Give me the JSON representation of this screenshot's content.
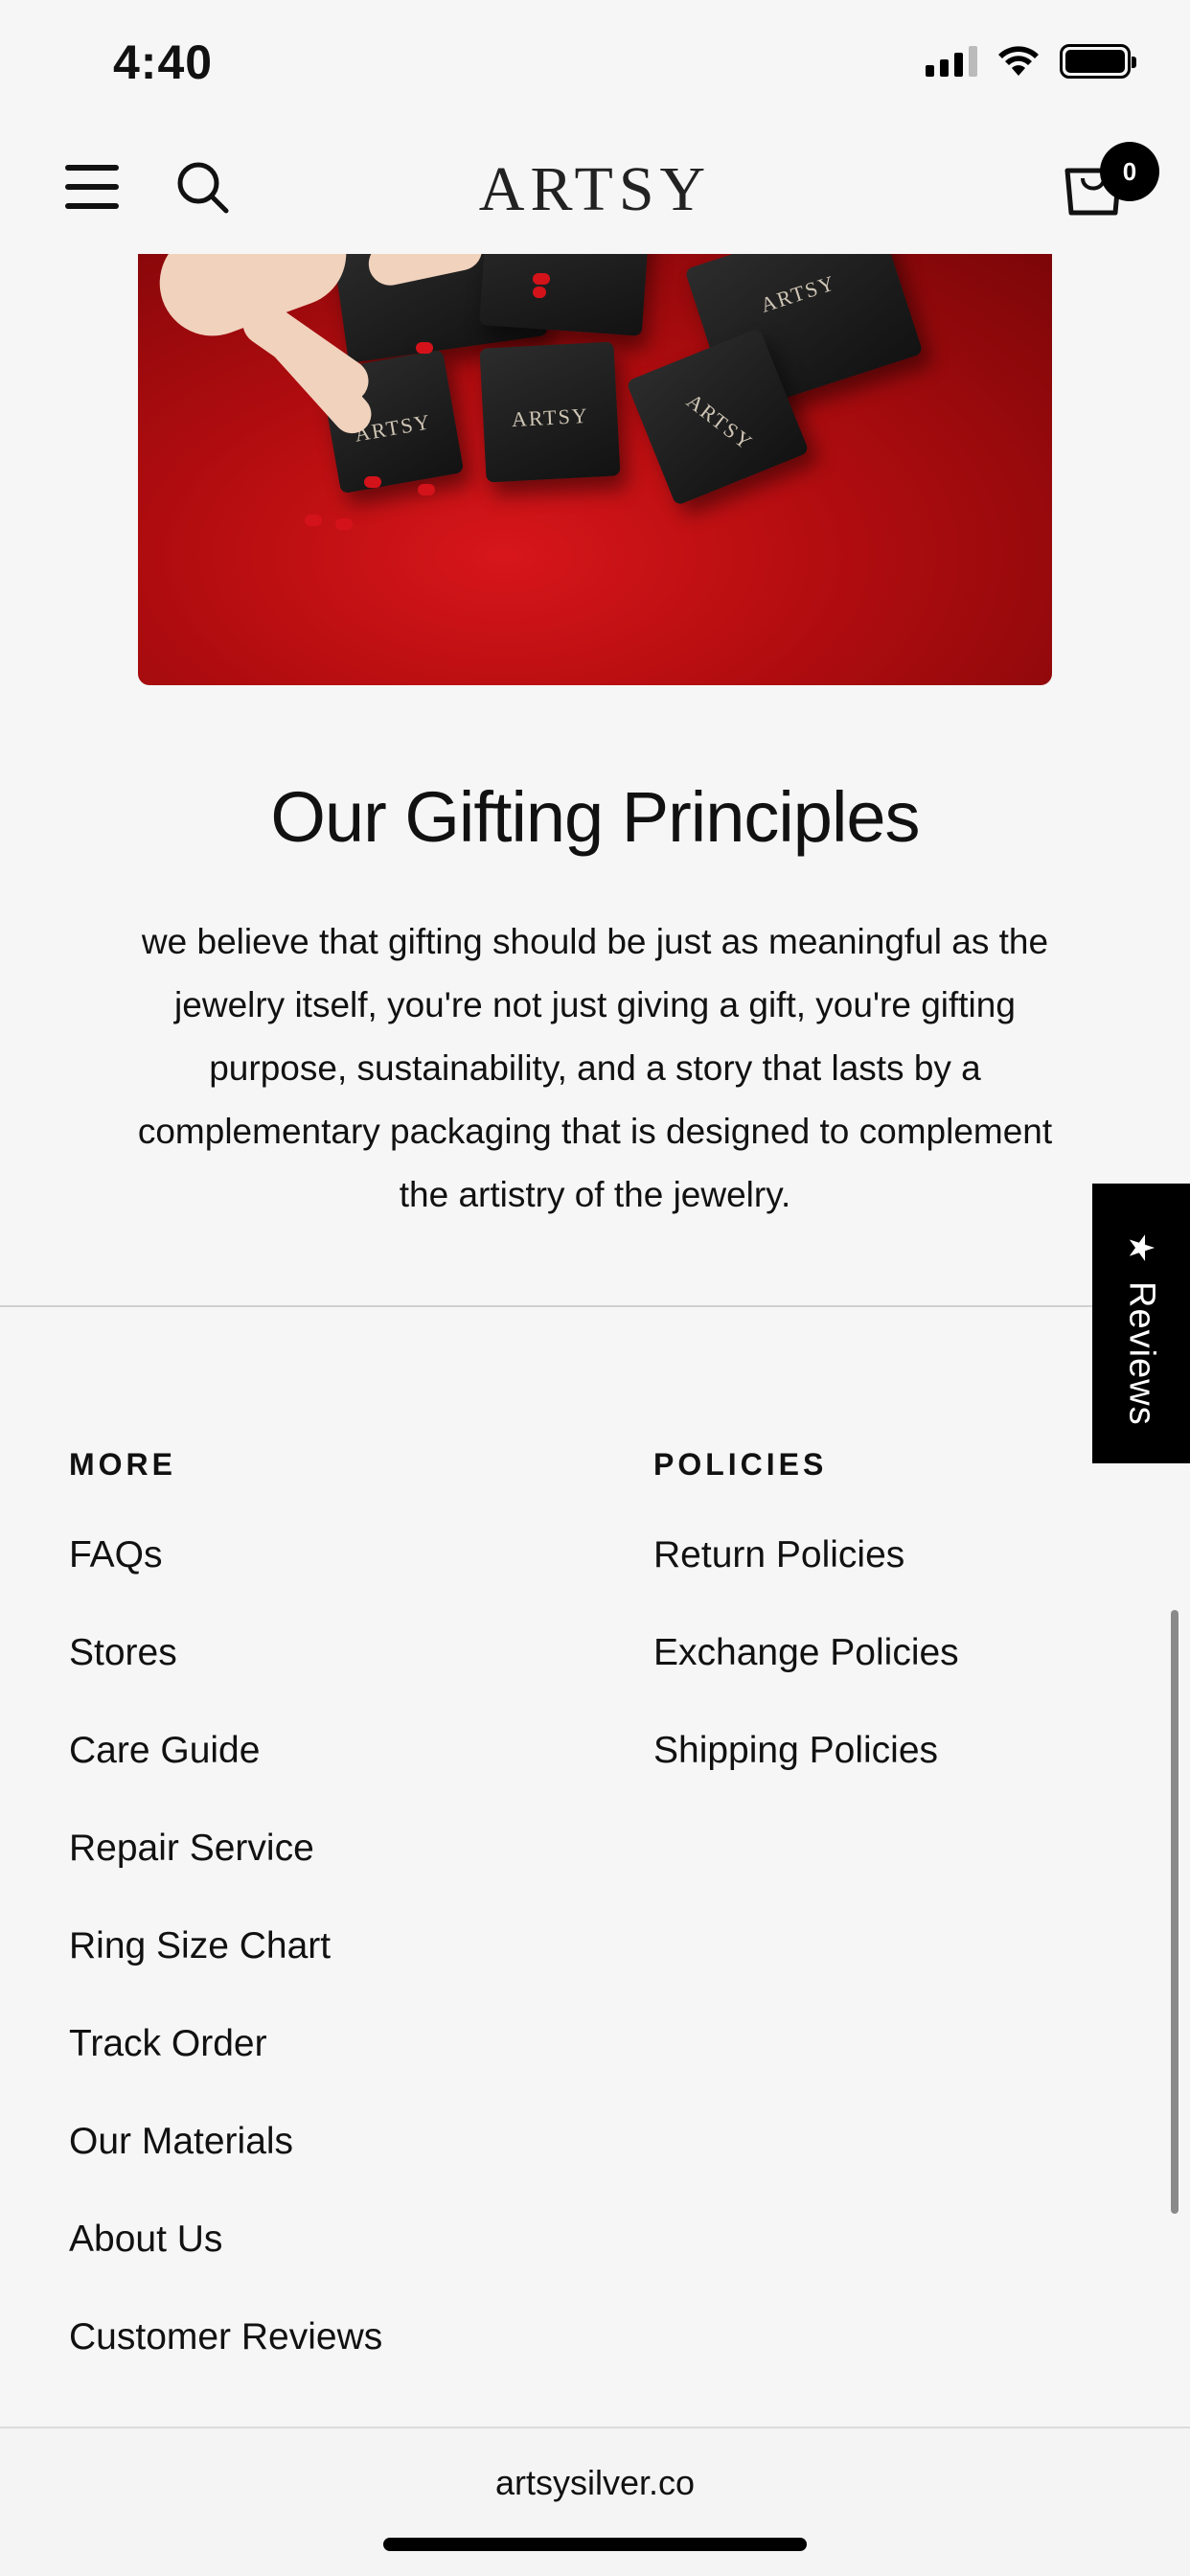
{
  "status_bar": {
    "time": "4:40"
  },
  "header": {
    "brand": "ARTSY",
    "cart_count": "0",
    "icons": [
      "menu-icon",
      "search-icon",
      "cart-icon"
    ]
  },
  "hero": {
    "box_labels": [
      "ARTSY",
      "ARTSY",
      "ARTSY",
      "ARTSY"
    ],
    "colors": {
      "background": "#b40d10",
      "box": "#1a1a1a"
    }
  },
  "gifting": {
    "title": "Our Gifting Principles",
    "body": "we believe that gifting should be just as meaningful as the jewelry itself, you're not just giving a gift, you're gifting purpose, sustainability, and a story that lasts by a complementary packaging that is designed to complement the artistry of the jewelry."
  },
  "reviews_tab": {
    "label": "Reviews"
  },
  "footer": {
    "more": {
      "heading": "MORE",
      "items": [
        "FAQs",
        "Stores",
        "Care Guide",
        "Repair Service",
        "Ring Size Chart",
        "Track Order",
        "Our Materials",
        "About Us",
        "Customer Reviews"
      ]
    },
    "policies": {
      "heading": "POLICIES",
      "items": [
        "Return Policies",
        "Exchange Policies",
        "Shipping Policies"
      ]
    }
  },
  "browser": {
    "url": "artsysilver.co"
  }
}
